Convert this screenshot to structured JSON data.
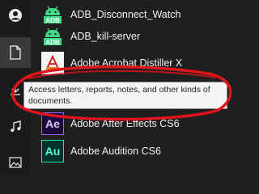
{
  "rail": {
    "items": [
      {
        "icon": "user-icon"
      },
      {
        "icon": "document-icon",
        "active": true
      },
      {
        "icon": "download-icon"
      },
      {
        "icon": "music-icon"
      },
      {
        "icon": "pictures-icon"
      }
    ]
  },
  "apps": [
    {
      "label": "ADB_Disconnect_Watch",
      "icon": "android-icon",
      "tile_text": "ADB"
    },
    {
      "label": "ADB_kill-server",
      "icon": "android-icon",
      "tile_text": "ADB"
    },
    {
      "label": "Adobe Acrobat Distiller X",
      "icon": "acrobat-distiller-icon"
    },
    {
      "label": "Adobe After Effects CS6",
      "icon": "after-effects-icon",
      "tile_text": "Ae"
    },
    {
      "label": "Adobe Audition CS6",
      "icon": "audition-icon",
      "tile_text": "Au"
    }
  ],
  "tooltip": {
    "text": "Access letters, reports, notes, and other kinds of documents."
  },
  "colors": {
    "android_green": "#3ddc84",
    "annotation_red": "#e0141b",
    "after_effects_accent": "#8d6bff",
    "audition_accent": "#1de9b6"
  }
}
